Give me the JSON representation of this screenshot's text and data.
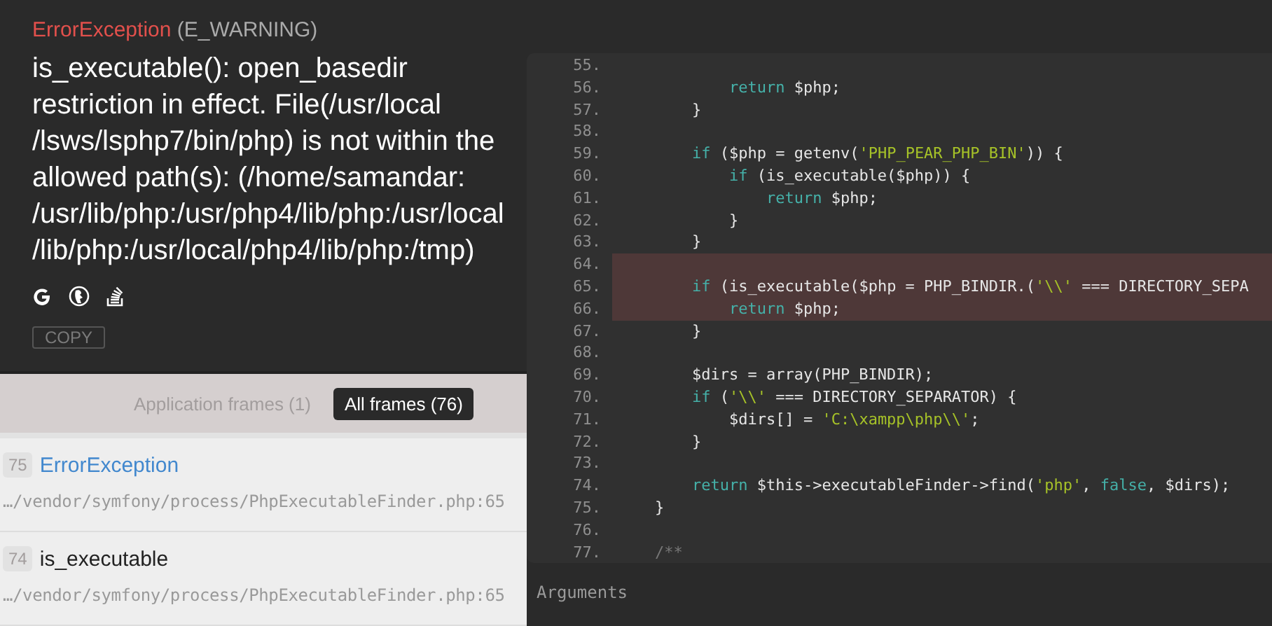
{
  "exception": {
    "class": "ErrorException",
    "code": "(E_WARNING)",
    "message": "is_executable(): open_basedir restriction in effect. File(/usr/local /lsws/lsphp7/bin/php) is not within the allowed path(s): (/home/samandar: /usr/lib/php:/usr/php4/lib/php:/usr/local /lib/php:/usr/local/php4/lib/php:/tmp)",
    "copy_button": "COPY"
  },
  "frame_filters": [
    {
      "label": "Application frames (1)",
      "selected": false
    },
    {
      "label": "All frames (76)",
      "selected": true
    }
  ],
  "frames": [
    {
      "number": "75",
      "name": "ErrorException",
      "kind": "class",
      "file": "…/vendor/symfony/process/PhpExecutableFinder.php:65"
    },
    {
      "number": "74",
      "name": "is_executable",
      "kind": "function",
      "file": "…/vendor/symfony/process/PhpExecutableFinder.php:65"
    }
  ],
  "code": [
    {
      "number": "55.",
      "highlighted": false
    },
    {
      "number": "56.",
      "highlighted": false,
      "tokens": [
        {
          "kind": "keyword",
          "text": "            return"
        },
        {
          "kind": "plain",
          "text": " $php;"
        }
      ]
    },
    {
      "number": "57.",
      "highlighted": false,
      "tokens": [
        {
          "kind": "plain",
          "text": "        }"
        }
      ]
    },
    {
      "number": "58.",
      "highlighted": false
    },
    {
      "number": "59.",
      "highlighted": false,
      "tokens": [
        {
          "kind": "keyword",
          "text": "        if"
        },
        {
          "kind": "plain",
          "text": " ($php = getenv("
        },
        {
          "kind": "string",
          "text": "'PHP_PEAR_PHP_BIN'"
        },
        {
          "kind": "plain",
          "text": ")) {"
        }
      ]
    },
    {
      "number": "60.",
      "highlighted": false,
      "tokens": [
        {
          "kind": "keyword",
          "text": "            if"
        },
        {
          "kind": "plain",
          "text": " (is_executable($php)) {"
        }
      ]
    },
    {
      "number": "61.",
      "highlighted": false,
      "tokens": [
        {
          "kind": "keyword",
          "text": "                return"
        },
        {
          "kind": "plain",
          "text": " $php;"
        }
      ]
    },
    {
      "number": "62.",
      "highlighted": false,
      "tokens": [
        {
          "kind": "plain",
          "text": "            }"
        }
      ]
    },
    {
      "number": "63.",
      "highlighted": false,
      "tokens": [
        {
          "kind": "plain",
          "text": "        }"
        }
      ]
    },
    {
      "number": "64.",
      "highlighted": true
    },
    {
      "number": "65.",
      "highlighted": true,
      "tokens": [
        {
          "kind": "keyword",
          "text": "        if"
        },
        {
          "kind": "plain",
          "text": " (is_executable($php = PHP_BINDIR.("
        },
        {
          "kind": "string",
          "text": "'\\\\'"
        },
        {
          "kind": "plain",
          "text": " === DIRECTORY_SEPA"
        }
      ]
    },
    {
      "number": "66.",
      "highlighted": true,
      "tokens": [
        {
          "kind": "keyword",
          "text": "            return"
        },
        {
          "kind": "plain",
          "text": " $php;"
        }
      ]
    },
    {
      "number": "67.",
      "highlighted": false,
      "tokens": [
        {
          "kind": "plain",
          "text": "        }"
        }
      ]
    },
    {
      "number": "68.",
      "highlighted": false
    },
    {
      "number": "69.",
      "highlighted": false,
      "tokens": [
        {
          "kind": "plain",
          "text": "        $dirs = array(PHP_BINDIR);"
        }
      ]
    },
    {
      "number": "70.",
      "highlighted": false,
      "tokens": [
        {
          "kind": "keyword",
          "text": "        if"
        },
        {
          "kind": "plain",
          "text": " ("
        },
        {
          "kind": "string",
          "text": "'\\\\'"
        },
        {
          "kind": "plain",
          "text": " === DIRECTORY_SEPARATOR) {"
        }
      ]
    },
    {
      "number": "71.",
      "highlighted": false,
      "tokens": [
        {
          "kind": "plain",
          "text": "            $dirs[] = "
        },
        {
          "kind": "string",
          "text": "'C:\\xampp\\php\\\\'"
        },
        {
          "kind": "plain",
          "text": ";"
        }
      ]
    },
    {
      "number": "72.",
      "highlighted": false,
      "tokens": [
        {
          "kind": "plain",
          "text": "        }"
        }
      ]
    },
    {
      "number": "73.",
      "highlighted": false
    },
    {
      "number": "74.",
      "highlighted": false,
      "tokens": [
        {
          "kind": "keyword",
          "text": "        return"
        },
        {
          "kind": "plain",
          "text": " $this->executableFinder->find("
        },
        {
          "kind": "string",
          "text": "'php'"
        },
        {
          "kind": "plain",
          "text": ", "
        },
        {
          "kind": "keyword",
          "text": "false"
        },
        {
          "kind": "plain",
          "text": ", $dirs);"
        }
      ]
    },
    {
      "number": "75.",
      "highlighted": false,
      "tokens": [
        {
          "kind": "plain",
          "text": "    }"
        }
      ]
    },
    {
      "number": "76.",
      "highlighted": false
    },
    {
      "number": "77.",
      "highlighted": false,
      "tokens": [
        {
          "kind": "comment",
          "text": "    /**"
        }
      ]
    }
  ],
  "arguments_label": "Arguments"
}
